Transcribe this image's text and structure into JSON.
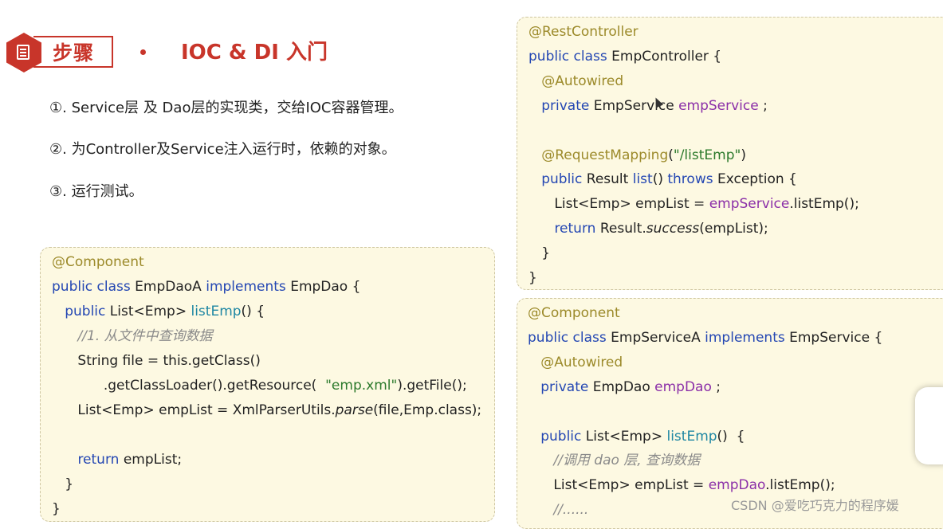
{
  "header": {
    "step_label": "步骤",
    "title": "IOC & DI 入门",
    "icon": "document-icon"
  },
  "steps": [
    "①. Service层 及 Dao层的实现类，交给IOC容器管理。",
    "②. 为Controller及Service注入运行时，依赖的对象。",
    "③. 运行测试。"
  ],
  "code_dao": [
    [
      [
        "ann",
        "@Component"
      ]
    ],
    [
      [
        "kw",
        "public class "
      ],
      [
        "t",
        "EmpDaoA "
      ],
      [
        "kw",
        "implements "
      ],
      [
        "t",
        "EmpDao {"
      ]
    ],
    [
      [
        "t",
        "   "
      ],
      [
        "kw",
        "public "
      ],
      [
        "t",
        "List<Emp> "
      ],
      [
        "fn",
        "listEmp"
      ],
      [
        "t",
        "() {"
      ]
    ],
    [
      [
        "t",
        "      "
      ],
      [
        "cmt",
        "//1. 从文件中查询数据"
      ]
    ],
    [
      [
        "t",
        "      String file = this.getClass()"
      ]
    ],
    [
      [
        "t",
        "            .getClassLoader().getResource(  "
      ],
      [
        "str",
        "\"emp.xml\""
      ],
      [
        "t",
        ").getFile();"
      ]
    ],
    [
      [
        "t",
        "      List<Emp> empList = XmlParserUtils."
      ],
      [
        "it",
        "parse"
      ],
      [
        "t",
        "(file,Emp.class);"
      ]
    ],
    [
      [
        "t",
        ""
      ]
    ],
    [
      [
        "t",
        "      "
      ],
      [
        "kw",
        "return "
      ],
      [
        "t",
        "empList;"
      ]
    ],
    [
      [
        "t",
        "   }"
      ]
    ],
    [
      [
        "t",
        "}"
      ]
    ]
  ],
  "code_controller": [
    [
      [
        "ann",
        "@RestController"
      ]
    ],
    [
      [
        "kw",
        "public class "
      ],
      [
        "t",
        "EmpController {"
      ]
    ],
    [
      [
        "t",
        "   "
      ],
      [
        "ann",
        "@Autowired"
      ]
    ],
    [
      [
        "t",
        "   "
      ],
      [
        "kw",
        "private "
      ],
      [
        "t",
        "EmpService "
      ],
      [
        "fld",
        "empService"
      ],
      [
        "t",
        " ;"
      ]
    ],
    [
      [
        "t",
        ""
      ]
    ],
    [
      [
        "t",
        "   "
      ],
      [
        "ann",
        "@RequestMapping"
      ],
      [
        "t",
        "("
      ],
      [
        "str",
        "\"/listEmp\""
      ],
      [
        "t",
        ")"
      ]
    ],
    [
      [
        "t",
        "   "
      ],
      [
        "kw",
        "public "
      ],
      [
        "t",
        "Result "
      ],
      [
        "kw",
        "list"
      ],
      [
        "t",
        "() "
      ],
      [
        "kw",
        "throws "
      ],
      [
        "t",
        "Exception {"
      ]
    ],
    [
      [
        "t",
        "      List<Emp> empList = "
      ],
      [
        "fld",
        "empService"
      ],
      [
        "t",
        ".listEmp();"
      ]
    ],
    [
      [
        "t",
        "      "
      ],
      [
        "kw",
        "return "
      ],
      [
        "t",
        "Result."
      ],
      [
        "it",
        "success"
      ],
      [
        "t",
        "(empList);"
      ]
    ],
    [
      [
        "t",
        "   }"
      ]
    ],
    [
      [
        "t",
        "}"
      ]
    ]
  ],
  "code_service": [
    [
      [
        "ann",
        "@Component"
      ]
    ],
    [
      [
        "kw",
        "public class "
      ],
      [
        "t",
        "EmpServiceA "
      ],
      [
        "kw",
        "implements "
      ],
      [
        "t",
        "EmpService {"
      ]
    ],
    [
      [
        "t",
        "   "
      ],
      [
        "ann",
        "@Autowired"
      ]
    ],
    [
      [
        "t",
        "   "
      ],
      [
        "kw",
        "private "
      ],
      [
        "t",
        "EmpDao "
      ],
      [
        "fld",
        "empDao"
      ],
      [
        "t",
        " ;"
      ]
    ],
    [
      [
        "t",
        ""
      ]
    ],
    [
      [
        "t",
        "   "
      ],
      [
        "kw",
        "public "
      ],
      [
        "t",
        "List<Emp> "
      ],
      [
        "fn",
        "listEmp"
      ],
      [
        "t",
        "()  {"
      ]
    ],
    [
      [
        "t",
        "      "
      ],
      [
        "cmt",
        "//调用 dao 层, 查询数据"
      ]
    ],
    [
      [
        "t",
        "      List<Emp> empList = "
      ],
      [
        "fld",
        "empDao"
      ],
      [
        "t",
        ".listEmp();"
      ]
    ],
    [
      [
        "t",
        "      "
      ],
      [
        "cmt",
        "//......"
      ]
    ]
  ],
  "watermark": "CSDN @爱吃巧克力的程序媛",
  "colors": {
    "accent": "#c8352a",
    "card_bg": "#fdf9e2",
    "annotation": "#9c8a2a",
    "keyword": "#2447b3",
    "method": "#1f87a3",
    "field": "#8b2fa8",
    "string": "#2c7a2c",
    "comment": "#8a8a8a"
  }
}
